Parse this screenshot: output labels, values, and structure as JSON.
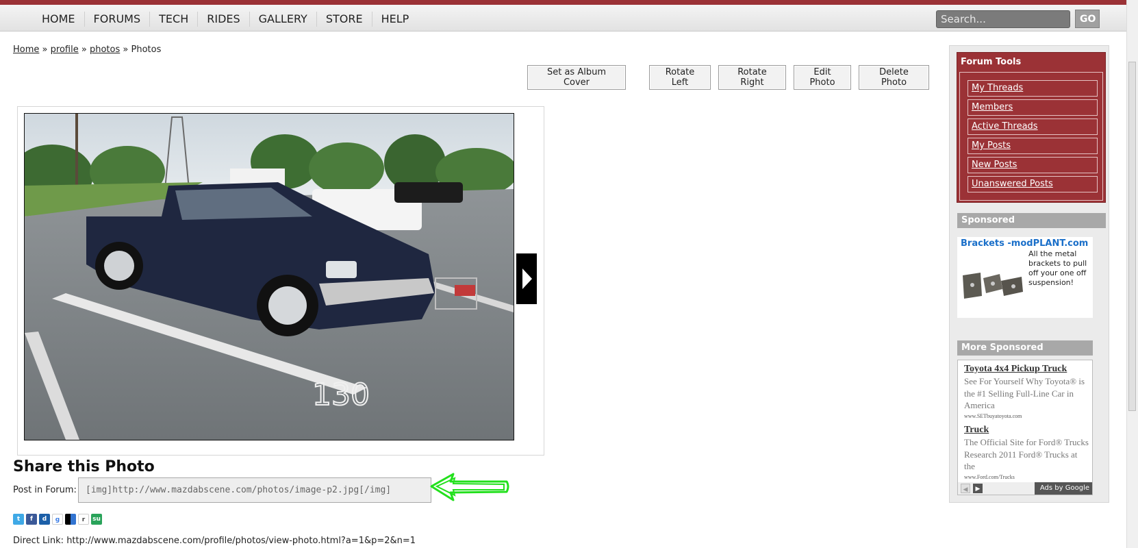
{
  "nav": {
    "items": [
      "HOME",
      "FORUMS",
      "TECH",
      "RIDES",
      "GALLERY",
      "STORE",
      "HELP"
    ]
  },
  "search": {
    "placeholder": "Search...",
    "go_label": "GO"
  },
  "breadcrumb": {
    "home": "Home",
    "sep1": "»",
    "profile": "profile",
    "sep2": "»",
    "photos": "photos",
    "sep3": "»",
    "current": "Photos"
  },
  "toolbar": {
    "album_cover": "Set as Album Cover",
    "rotate_left": "Rotate Left",
    "rotate_right": "Rotate Right",
    "edit_photo": "Edit Photo",
    "delete_photo": "Delete Photo"
  },
  "photo": {
    "plate_number": "130"
  },
  "share": {
    "title": "Share this Photo",
    "post_label": "Post in Forum:",
    "post_value": "[img]http://www.mazdabscene.com/photos/image-p2.jpg[/img]",
    "direct_link": "Direct Link: http://www.mazdabscene.com/profile/photos/view-photo.html?a=1&p=2&n=1"
  },
  "social_icons": [
    "twitter-icon",
    "facebook-icon",
    "digg-icon",
    "google-icon",
    "delicious-icon",
    "reddit-icon",
    "stumbleupon-icon"
  ],
  "forum_tools": {
    "title": "Forum Tools",
    "links": [
      "My Threads",
      "Members",
      "Active Threads",
      "My Posts",
      "New Posts",
      "Unanswered Posts"
    ]
  },
  "sponsored": {
    "title": "Sponsored",
    "ad_title": "Brackets -modPLANT.com",
    "ad_desc": "All the metal brackets to pull off your one off suspension!"
  },
  "more_sponsored": {
    "title": "More Sponsored",
    "ads": [
      {
        "title": "Toyota 4x4 Pickup Truck",
        "desc": "See For Yourself Why Toyota® is the #1 Selling Full-Line Car in America",
        "url": "www.SETbuyatoyota.com"
      },
      {
        "title": "Truck",
        "desc": "The Official Site for Ford® Trucks Research 2011 Ford® Trucks at the",
        "url": "www.Ford.com/Trucks"
      }
    ],
    "ads_by": "Ads by Google"
  },
  "colors": {
    "accent": "#9b3236",
    "annotation": "#22e01c",
    "sponsor_link": "#1a6fc9"
  }
}
